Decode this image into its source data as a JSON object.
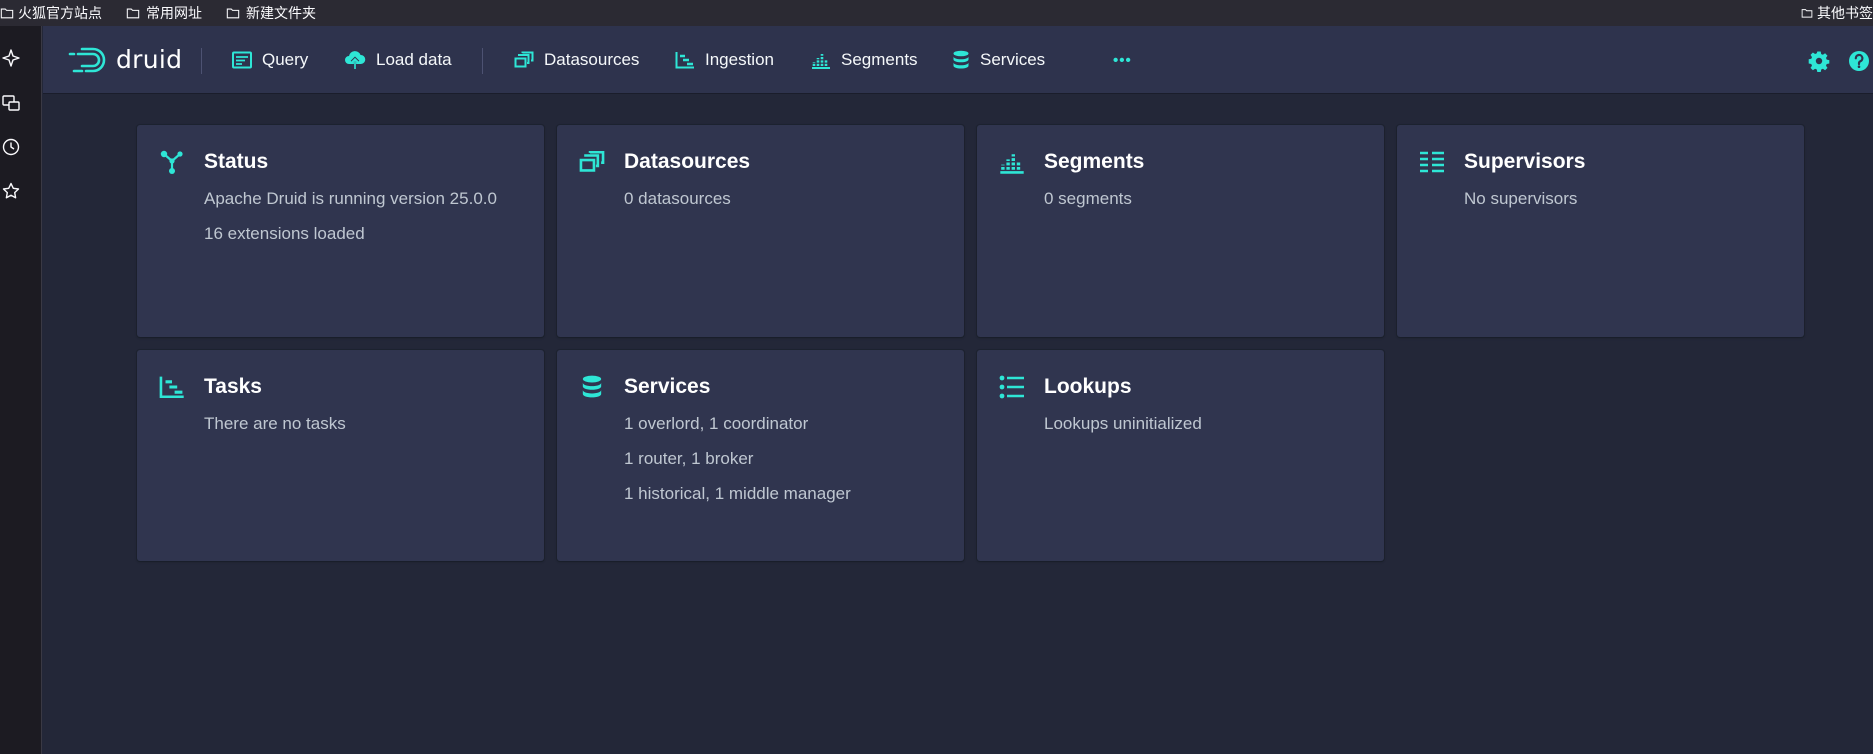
{
  "browser": {
    "bookmarks": [
      {
        "label": "火狐官方站点",
        "icon": "folder-icon"
      },
      {
        "label": "常用网址",
        "icon": "folder-icon"
      },
      {
        "label": "新建文件夹",
        "icon": "folder-icon"
      }
    ],
    "other_bookmarks": {
      "label": "其他书签",
      "icon": "folder-icon"
    },
    "sidebar_icons": [
      "sparkle-icon",
      "sync-tabs-icon",
      "history-icon",
      "bookmark-star-icon"
    ]
  },
  "header": {
    "logo_text": "druid",
    "nav": [
      {
        "label": "Query",
        "icon": "query-icon"
      },
      {
        "label": "Load data",
        "icon": "cloud-upload-icon"
      },
      {
        "label": "Datasources",
        "icon": "datasources-icon"
      },
      {
        "label": "Ingestion",
        "icon": "ingestion-icon"
      },
      {
        "label": "Segments",
        "icon": "segments-icon"
      },
      {
        "label": "Services",
        "icon": "database-icon"
      }
    ],
    "more_label": "•••",
    "right_icons": [
      "gear-icon",
      "help-icon"
    ]
  },
  "cards": [
    {
      "title": "Status",
      "icon": "graph-icon",
      "lines": [
        "Apache Druid is running version 25.0.0",
        "16 extensions loaded"
      ]
    },
    {
      "title": "Datasources",
      "icon": "datasources-icon",
      "lines": [
        "0 datasources"
      ]
    },
    {
      "title": "Segments",
      "icon": "segments-icon",
      "lines": [
        "0 segments"
      ]
    },
    {
      "title": "Supervisors",
      "icon": "supervisors-icon",
      "lines": [
        "No supervisors"
      ]
    },
    {
      "title": "Tasks",
      "icon": "tasks-icon",
      "lines": [
        "There are no tasks"
      ]
    },
    {
      "title": "Services",
      "icon": "database-icon",
      "lines": [
        "1 overlord, 1 coordinator",
        "1 router, 1 broker",
        "1 historical, 1 middle manager"
      ]
    },
    {
      "title": "Lookups",
      "icon": "lookups-icon",
      "lines": [
        "Lookups uninitialized"
      ]
    }
  ],
  "colors": {
    "accent": "#2ee6d6",
    "page_bg": "#232738",
    "header_bg": "#2e334d",
    "card_bg": "#30354f",
    "muted_text": "#bfc7d1"
  }
}
